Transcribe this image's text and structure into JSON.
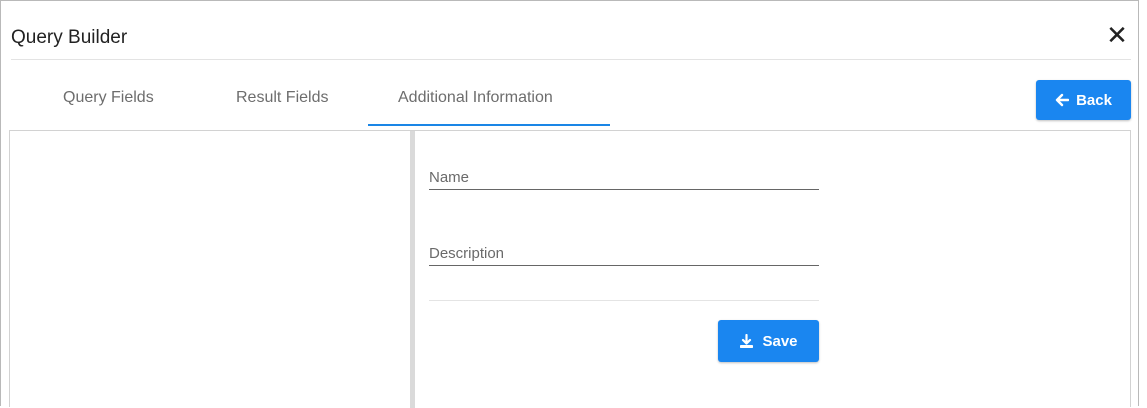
{
  "dialog": {
    "title": "Query Builder",
    "close_icon": "close-icon"
  },
  "tabs": [
    {
      "label": "Query Fields",
      "active": false
    },
    {
      "label": "Result Fields",
      "active": false
    },
    {
      "label": "Additional Information",
      "active": true
    }
  ],
  "back_button": {
    "label": "Back",
    "icon": "arrow-left-icon"
  },
  "form": {
    "name": {
      "placeholder": "Name",
      "value": ""
    },
    "description": {
      "placeholder": "Description",
      "value": ""
    },
    "save_button": {
      "label": "Save",
      "icon": "download-icon"
    }
  },
  "colors": {
    "accent": "#1a86f0",
    "tab_underline": "#1a86e6"
  }
}
